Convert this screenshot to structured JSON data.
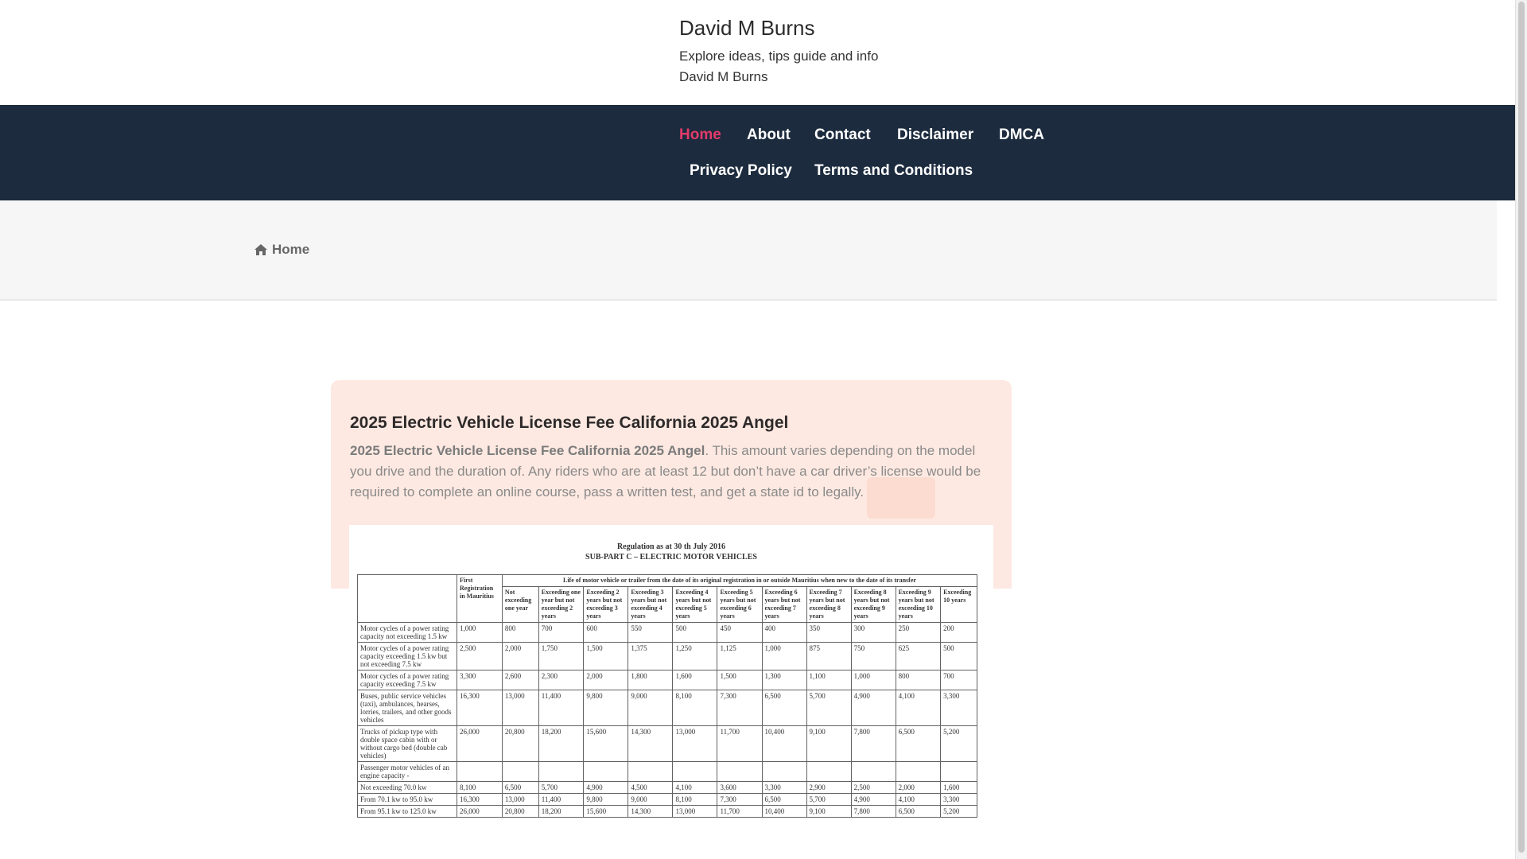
{
  "site": {
    "title": "David M Burns",
    "description": "Explore ideas, tips guide and info",
    "author": "David M Burns"
  },
  "nav": {
    "items": [
      {
        "label": "Home",
        "active": true
      },
      {
        "label": "About"
      },
      {
        "label": "Contact"
      },
      {
        "label": "Disclaimer"
      },
      {
        "label": "DMCA"
      },
      {
        "label": "Privacy Policy"
      },
      {
        "label": "Terms and Conditions"
      }
    ]
  },
  "breadcrumb": {
    "icon": "home-icon",
    "label": "Home"
  },
  "post": {
    "title": "2025 Electric Vehicle License Fee California 2025 Angel",
    "excerpt_bold": "2025 Electric Vehicle License Fee California 2025 Angel",
    "excerpt_rest": ". This amount varies depending on the model you drive and the duration of. Any riders who are at least 12 but don’t have a car driver’s license would be required to complete an online course, pass a written test, and get a state id to legally."
  },
  "image": {
    "heading_1": "Regulation as at 30 th July 2016",
    "heading_2": "SUB-PART C – ELECTRIC MOTOR VEHICLES",
    "group_header": "Life of motor vehicle or trailer from the date of its original registration in or outside Mauritius when new to the date of its transfer",
    "columns": [
      "First Registration in Mauritius",
      "Not exceeding one year",
      "Exceeding one year but not exceeding 2 years",
      "Exceeding 2 years but not exceeding 3 years",
      "Exceeding 3 years but not exceeding 4 years",
      "Exceeding 4 years but not exceeding 5 years",
      "Exceeding 5 years but not exceeding 6 years",
      "Exceeding 6 years but not exceeding 7 years",
      "Exceeding 7 years but not exceeding 8 years",
      "Exceeding 8 years but not exceeding 9 years",
      "Exceeding 9 years but not exceeding 10 years",
      "Exceeding 10 years"
    ],
    "rows": [
      {
        "desc": "Motor cycles of a power rating capacity not exceeding 1.5 kw",
        "values": [
          "1,000",
          "800",
          "700",
          "600",
          "550",
          "500",
          "450",
          "400",
          "350",
          "300",
          "250",
          "200"
        ]
      },
      {
        "desc": "Motor cycles of a power rating capacity exceeding 1.5 kw but not exceeding 7.5 kw",
        "values": [
          "2,500",
          "2,000",
          "1,750",
          "1,500",
          "1,375",
          "1,250",
          "1,125",
          "1,000",
          "875",
          "750",
          "625",
          "500"
        ]
      },
      {
        "desc": "Motor cycles of a power rating capacity exceeding 7.5 kw",
        "values": [
          "3,300",
          "2,600",
          "2,300",
          "2,000",
          "1,800",
          "1,600",
          "1,500",
          "1,300",
          "1,100",
          "1,000",
          "800",
          "700"
        ]
      },
      {
        "desc": "Buses, public service vehicles (taxi), ambulances, hearses, lorries, trailers, and other goods vehicles",
        "values": [
          "16,300",
          "13,000",
          "11,400",
          "9,800",
          "9,000",
          "8,100",
          "7,300",
          "6,500",
          "5,700",
          "4,900",
          "4,100",
          "3,300"
        ]
      },
      {
        "desc": "Trucks of pickup type with double space cabin with or without cargo bed (double cab vehicles)",
        "values": [
          "26,000",
          "20,800",
          "18,200",
          "15,600",
          "14,300",
          "13,000",
          "11,700",
          "10,400",
          "9,100",
          "7,800",
          "6,500",
          "5,200"
        ]
      },
      {
        "desc": "Passenger motor vehicles of an engine capacity -",
        "values": [
          "",
          "",
          "",
          "",
          "",
          "",
          "",
          "",
          "",
          "",
          "",
          ""
        ]
      },
      {
        "desc": "Not exceeding 70.0 kw",
        "values": [
          "8,100",
          "6,500",
          "5,700",
          "4,900",
          "4,500",
          "4,100",
          "3,600",
          "3,300",
          "2,900",
          "2,500",
          "2,000",
          "1,600"
        ]
      },
      {
        "desc": "From 70.1 kw to 95.0 kw",
        "values": [
          "16,300",
          "13,000",
          "11,400",
          "9,800",
          "9,000",
          "8,100",
          "7,300",
          "6,500",
          "5,700",
          "4,900",
          "4,100",
          "3,300"
        ]
      },
      {
        "desc": "From 95.1 kw to 125.0 kw",
        "values": [
          "26,000",
          "20,800",
          "18,200",
          "15,600",
          "14,300",
          "13,000",
          "11,700",
          "10,400",
          "9,100",
          "7,800",
          "6,500",
          "5,200"
        ]
      }
    ]
  },
  "colors": {
    "nav_bg": "#1c2b3e",
    "nav_active": "#e33b6b",
    "card_top": "#fde9e1",
    "breadcrumb_bg": "#f6f6f6"
  }
}
